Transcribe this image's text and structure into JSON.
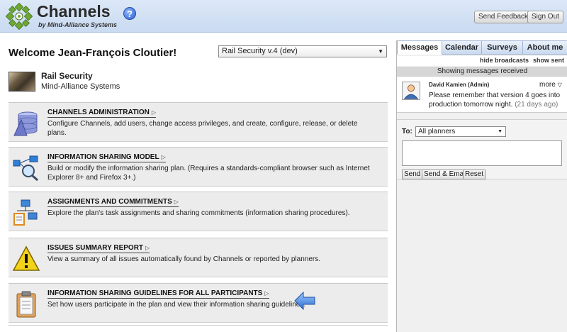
{
  "header": {
    "brand_title": "Channels",
    "brand_subtitle": "by Mind-Alliance Systems",
    "help_glyph": "?",
    "send_feedback_label": "Send Feedback",
    "sign_out_label": "Sign Out"
  },
  "welcome": {
    "text": "Welcome Jean-François Cloutier!",
    "plan_selector_value": "Rail Security v.4 (dev)"
  },
  "plan": {
    "name": "Rail Security",
    "organization": "Mind-Alliance Systems"
  },
  "cards": [
    {
      "title": "CHANNELS ADMINISTRATION",
      "description": "Configure Channels, add users, change access privileges, and create, configure, release, or delete plans.",
      "icon": "database-icon"
    },
    {
      "title": "INFORMATION SHARING MODEL",
      "description": "Build or modify the information sharing plan. (Requires a standards-compliant browser such as Internet Explorer 8+ and Firefox 3+.)",
      "icon": "network-search-icon"
    },
    {
      "title": "ASSIGNMENTS AND COMMITMENTS",
      "description": "Explore the plan's task assignments and sharing commitments (information sharing procedures).",
      "icon": "org-chart-icon"
    },
    {
      "title": "ISSUES SUMMARY REPORT",
      "description": "View a summary of all issues automatically found by Channels or reported by planners.",
      "icon": "warning-icon"
    },
    {
      "title": "INFORMATION SHARING GUIDELINES FOR ALL PARTICIPANTS",
      "description": "Set how users participate in the plan and view their information sharing guidelines.",
      "icon": "clipboard-icon"
    }
  ],
  "tabs": [
    {
      "label": "Messages",
      "active": true
    },
    {
      "label": "Calendar",
      "active": false
    },
    {
      "label": "Surveys",
      "active": false
    },
    {
      "label": "About me",
      "active": false
    }
  ],
  "messages": {
    "hide_broadcasts_label": "hide broadcasts",
    "show_sent_label": "show sent",
    "heading": "Showing messages received",
    "items": [
      {
        "sender": "David Kamien (Admin)",
        "more_label": "more",
        "text": "Please remember that version 4 goes into production tomorrow night.",
        "age": "(21 days ago)"
      }
    ]
  },
  "compose": {
    "to_label": "To:",
    "to_value": "All planners",
    "send_label": "Send",
    "send_email_label": "Send & Email",
    "reset_label": "Reset"
  },
  "colors": {
    "header_bg": "#c9daf1",
    "accent_blue": "#2a5ecf",
    "card_bg": "#ececec",
    "warning_yellow": "#f3d21a"
  }
}
